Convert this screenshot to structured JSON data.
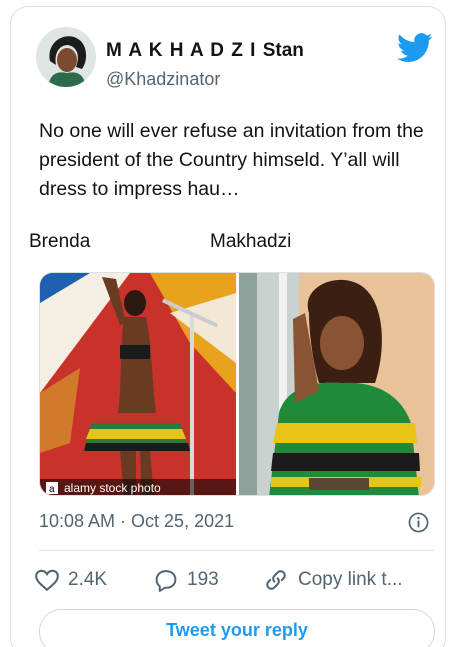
{
  "author": {
    "display_name": "M A K H A D Z I",
    "display_name_suffix": "Stan",
    "handle": "@Khadzinator"
  },
  "tweet": {
    "text": "No one will ever refuse an invitation from the president of the Country himseld. Y’all will dress to impress hau…",
    "captions": [
      "Brenda",
      "Makhadzi"
    ],
    "watermark": "alamy stock photo",
    "timestamp": "10:08 AM · Oct 25, 2021"
  },
  "actions": {
    "likes": "2.4K",
    "replies": "193",
    "share_label": "Copy link t..."
  },
  "reply": {
    "label": "Tweet your reply"
  },
  "colors": {
    "accent": "#1d9bf0",
    "muted": "#536471"
  },
  "icons": [
    "twitter-bird-icon",
    "info-icon",
    "heart-icon",
    "reply-bubble-icon",
    "link-icon"
  ]
}
